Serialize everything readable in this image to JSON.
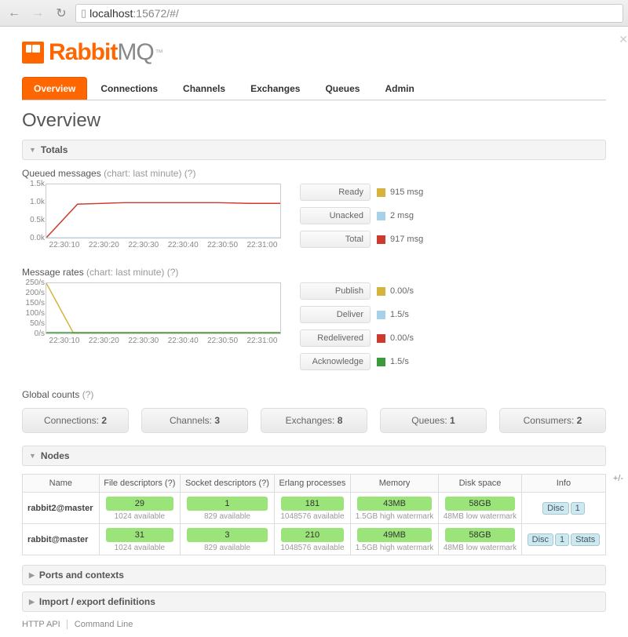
{
  "browser": {
    "url_host": "localhost",
    "url_rest": ":15672/#/"
  },
  "logo": {
    "part1": "Rabbit",
    "part2": "MQ",
    "tm": "™"
  },
  "tabs": [
    "Overview",
    "Connections",
    "Channels",
    "Exchanges",
    "Queues",
    "Admin"
  ],
  "page_title": "Overview",
  "sections": {
    "totals": "Totals",
    "nodes": "Nodes",
    "ports": "Ports and contexts",
    "importexport": "Import / export definitions"
  },
  "queued": {
    "title": "Queued messages",
    "chart_note": "(chart: last minute)",
    "help": "(?)",
    "legend": [
      {
        "label": "Ready",
        "value": "915 msg",
        "color": "#d6b33d"
      },
      {
        "label": "Unacked",
        "value": "2 msg",
        "color": "#a7d1e8"
      },
      {
        "label": "Total",
        "value": "917 msg",
        "color": "#cc3b2e"
      }
    ]
  },
  "rates": {
    "title": "Message rates",
    "chart_note": "(chart: last minute)",
    "help": "(?)",
    "legend": [
      {
        "label": "Publish",
        "value": "0.00/s",
        "color": "#d6b33d"
      },
      {
        "label": "Deliver",
        "value": "1.5/s",
        "color": "#a7d1e8"
      },
      {
        "label": "Redelivered",
        "value": "0.00/s",
        "color": "#cc3b2e"
      },
      {
        "label": "Acknowledge",
        "value": "1.5/s",
        "color": "#3b9b3b"
      }
    ]
  },
  "global": {
    "title": "Global counts",
    "help": "(?)",
    "items": [
      {
        "label": "Connections:",
        "value": "2"
      },
      {
        "label": "Channels:",
        "value": "3"
      },
      {
        "label": "Exchanges:",
        "value": "8"
      },
      {
        "label": "Queues:",
        "value": "1"
      },
      {
        "label": "Consumers:",
        "value": "2"
      }
    ]
  },
  "nodes": {
    "plusminus": "+/-",
    "headers": [
      "Name",
      "File descriptors (?)",
      "Socket descriptors (?)",
      "Erlang processes",
      "Memory",
      "Disk space",
      "Info"
    ],
    "rows": [
      {
        "name": "rabbit2@master",
        "cells": [
          {
            "val": "29",
            "sub": "1024 available"
          },
          {
            "val": "1",
            "sub": "829 available"
          },
          {
            "val": "181",
            "sub": "1048576 available"
          },
          {
            "val": "43MB",
            "sub": "1.5GB high watermark"
          },
          {
            "val": "58GB",
            "sub": "48MB low watermark"
          }
        ],
        "info": [
          "Disc",
          "1"
        ]
      },
      {
        "name": "rabbit@master",
        "cells": [
          {
            "val": "31",
            "sub": "1024 available"
          },
          {
            "val": "3",
            "sub": "829 available"
          },
          {
            "val": "210",
            "sub": "1048576 available"
          },
          {
            "val": "49MB",
            "sub": "1.5GB high watermark"
          },
          {
            "val": "58GB",
            "sub": "48MB low watermark"
          }
        ],
        "info": [
          "Disc",
          "1",
          "Stats"
        ]
      }
    ]
  },
  "footer": [
    "HTTP API",
    "Command Line"
  ],
  "chart_data": [
    {
      "type": "line",
      "title": "Queued messages (last minute)",
      "x": [
        "22:30:10",
        "22:30:20",
        "22:30:30",
        "22:30:40",
        "22:30:50",
        "22:31:00"
      ],
      "series": [
        {
          "name": "Total",
          "color": "#cc3b2e",
          "values": [
            0,
            900,
            920,
            920,
            920,
            917
          ]
        },
        {
          "name": "Ready",
          "color": "#d6b33d",
          "values": [
            0,
            898,
            918,
            918,
            918,
            915
          ]
        },
        {
          "name": "Unacked",
          "color": "#a7d1e8",
          "values": [
            0,
            2,
            2,
            2,
            2,
            2
          ]
        }
      ],
      "ylim": [
        0,
        1500
      ],
      "yticks": [
        "0.0k",
        "0.5k",
        "1.0k",
        "1.5k"
      ]
    },
    {
      "type": "line",
      "title": "Message rates (last minute)",
      "x": [
        "22:30:10",
        "22:30:20",
        "22:30:30",
        "22:30:40",
        "22:30:50",
        "22:31:00"
      ],
      "series": [
        {
          "name": "Publish",
          "color": "#d6b33d",
          "values": [
            250,
            0,
            0,
            0,
            0,
            0
          ]
        },
        {
          "name": "Deliver",
          "color": "#a7d1e8",
          "values": [
            1.5,
            1.5,
            1.5,
            1.5,
            1.5,
            1.5
          ]
        },
        {
          "name": "Redelivered",
          "color": "#cc3b2e",
          "values": [
            0,
            0,
            0,
            0,
            0,
            0
          ]
        },
        {
          "name": "Acknowledge",
          "color": "#3b9b3b",
          "values": [
            1.5,
            1.5,
            1.5,
            1.5,
            1.5,
            1.5
          ]
        }
      ],
      "ylim": [
        0,
        250
      ],
      "yticks": [
        "0/s",
        "50/s",
        "100/s",
        "150/s",
        "200/s",
        "250/s"
      ]
    }
  ]
}
